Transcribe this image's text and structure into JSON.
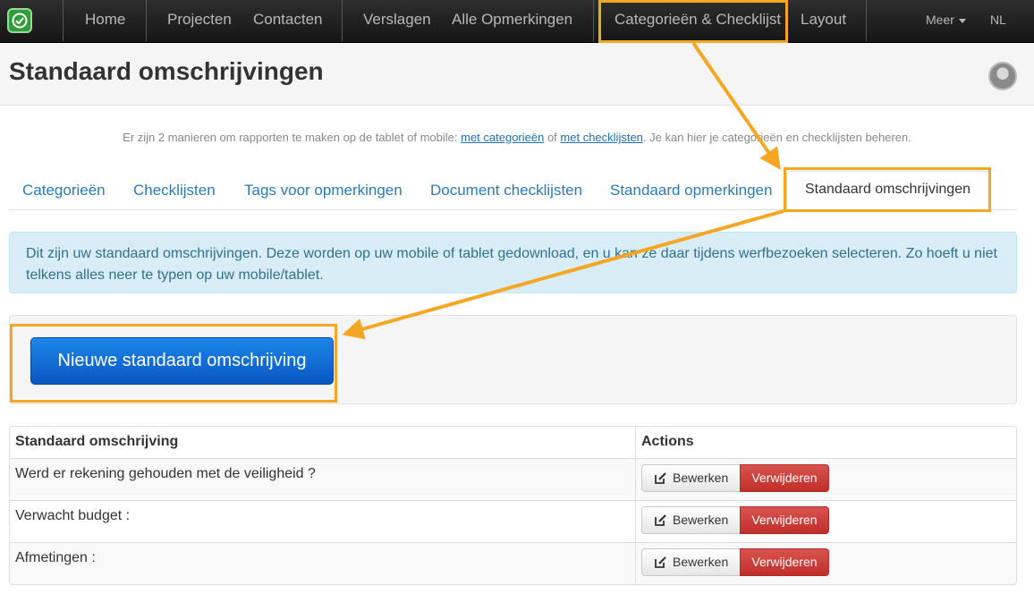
{
  "navbar": {
    "items": [
      "Home",
      "Projecten",
      "Contacten",
      "Verslagen",
      "Alle Opmerkingen",
      "Categorieën & Checklijst",
      "Layout"
    ],
    "more": "Meer",
    "language": "NL"
  },
  "header": {
    "title": "Standaard omschrijvingen"
  },
  "intro": {
    "text_before": "Er zijn 2 manieren om rapporten te maken op de tablet of mobile: ",
    "link1": "met categorieën",
    "text_middle": " of ",
    "link2": "met checklijsten",
    "text_after": ". Je kan hier je categorieën en checklijsten beheren."
  },
  "tabs": [
    "Categorieën",
    "Checklijsten",
    "Tags voor opmerkingen",
    "Document checklijsten",
    "Standaard opmerkingen",
    "Standaard omschrijvingen"
  ],
  "active_tab": "Standaard omschrijvingen",
  "alert": {
    "text": "Dit zijn uw standaard omschrijvingen. Deze worden op uw mobile of tablet gedownload, en u kan ze daar tijdens werfbezoeken selecteren. Zo hoeft u niet telkens alles neer te typen op uw mobile/tablet."
  },
  "new_button": "Nieuwe standaard omschrijving",
  "table": {
    "headers": [
      "Standaard omschrijving",
      "Actions"
    ],
    "rows": [
      {
        "label": "Werd er rekening gehouden met de veiligheid ?"
      },
      {
        "label": "Verwacht budget :"
      },
      {
        "label": "Afmetingen :"
      }
    ],
    "edit_label": "Bewerken",
    "delete_label": "Verwijderen"
  },
  "colors": {
    "annotation": "#f5a623",
    "primary": "#0a6ed1",
    "danger": "#d9534f",
    "link": "#2a7ab8"
  },
  "icons": {
    "logo": "check-icon",
    "edit": "edit-icon"
  }
}
